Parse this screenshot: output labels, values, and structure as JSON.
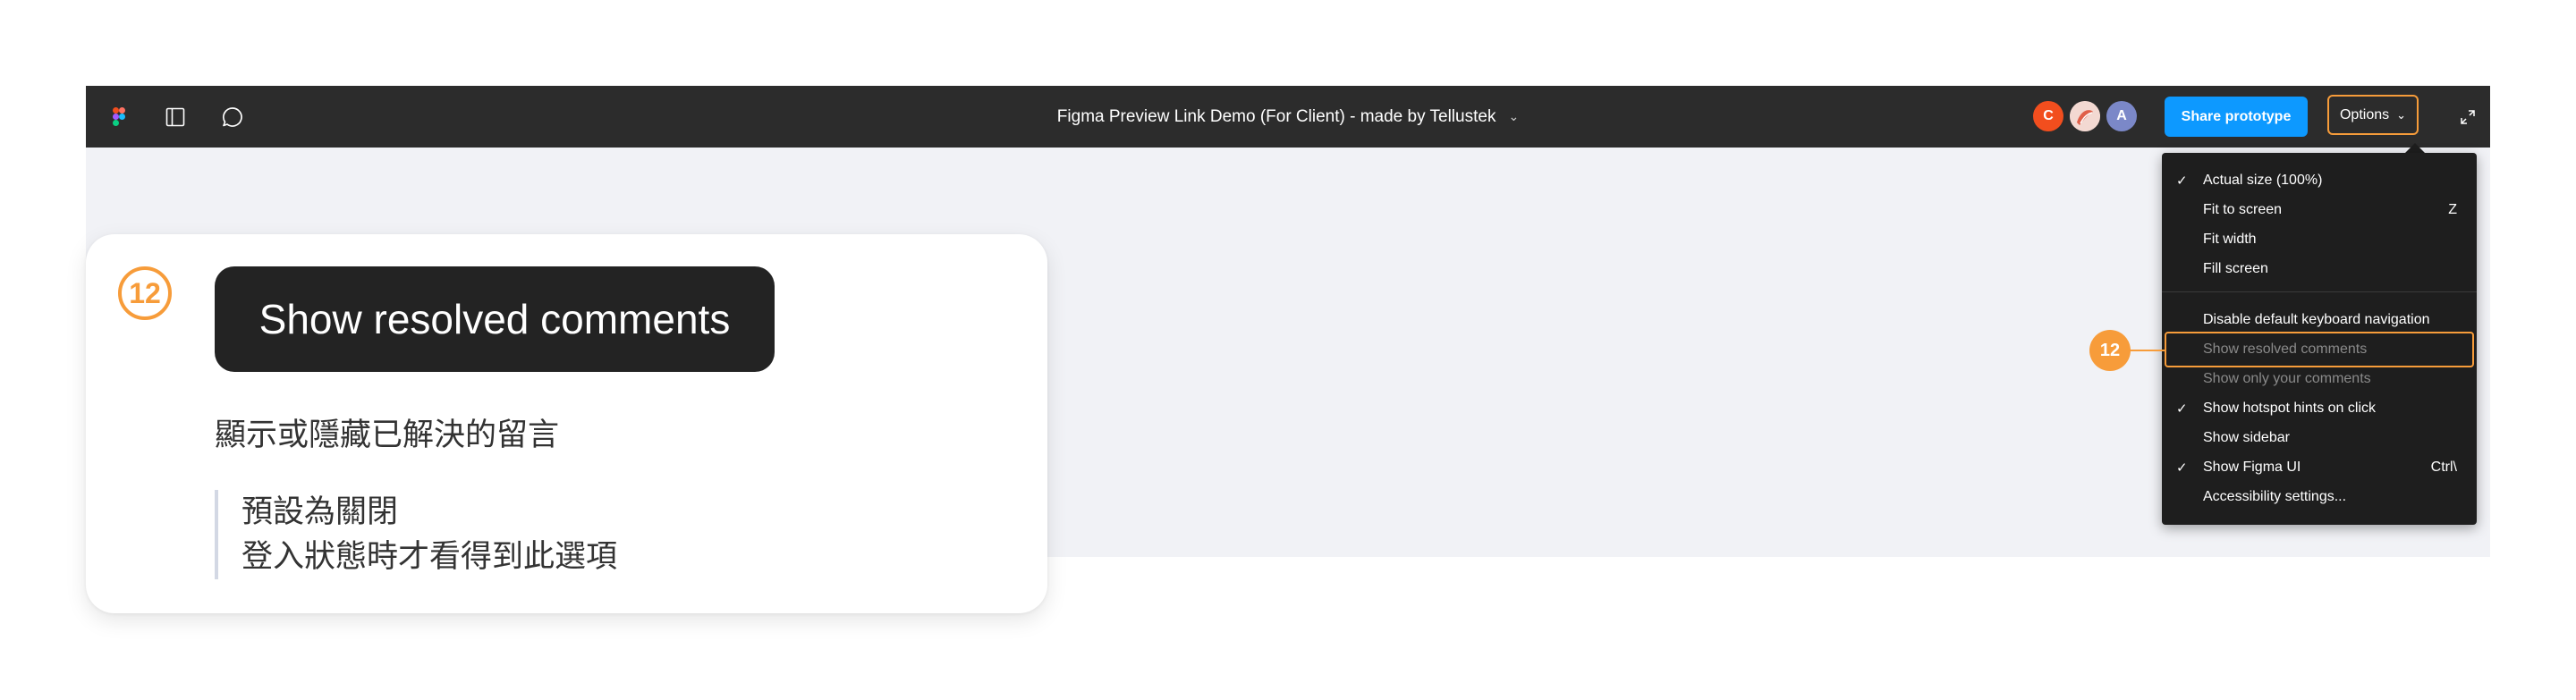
{
  "toolbar": {
    "title": "Figma Preview Link Demo (For Client) - made by Tellustek",
    "title_chevron": "⌄",
    "avatars": [
      "C",
      "A"
    ],
    "share_label": "Share prototype",
    "options_label": "Options",
    "options_chevron": "⌄"
  },
  "menu": {
    "items": [
      {
        "check": "✓",
        "label": "Actual size (100%)",
        "shortcut": ""
      },
      {
        "check": "",
        "label": "Fit to screen",
        "shortcut": "Z"
      },
      {
        "check": "",
        "label": "Fit width",
        "shortcut": ""
      },
      {
        "check": "",
        "label": "Fill screen",
        "shortcut": ""
      },
      {
        "check": "",
        "label": "Disable default keyboard navigation",
        "shortcut": ""
      },
      {
        "check": "",
        "label": "Show resolved comments",
        "shortcut": ""
      },
      {
        "check": "",
        "label": "Show only your comments",
        "shortcut": ""
      },
      {
        "check": "✓",
        "label": "Show hotspot hints on click",
        "shortcut": ""
      },
      {
        "check": "",
        "label": "Show sidebar",
        "shortcut": ""
      },
      {
        "check": "✓",
        "label": "Show Figma UI",
        "shortcut": "Ctrl\\"
      },
      {
        "check": "",
        "label": "Accessibility settings...",
        "shortcut": ""
      }
    ]
  },
  "annotation": {
    "badge": "12",
    "pill_label": "Show resolved comments",
    "description": "顯示或隱藏已解決的留言",
    "notes": [
      "預設為關閉",
      "登入狀態時才看得到此選項"
    ]
  },
  "colors": {
    "accent": "#f79c3a",
    "share_blue": "#0d99ff",
    "toolbar_bg": "#2c2c2c",
    "menu_bg": "#1e1e1e",
    "canvas_bg": "#f1f2f6"
  }
}
